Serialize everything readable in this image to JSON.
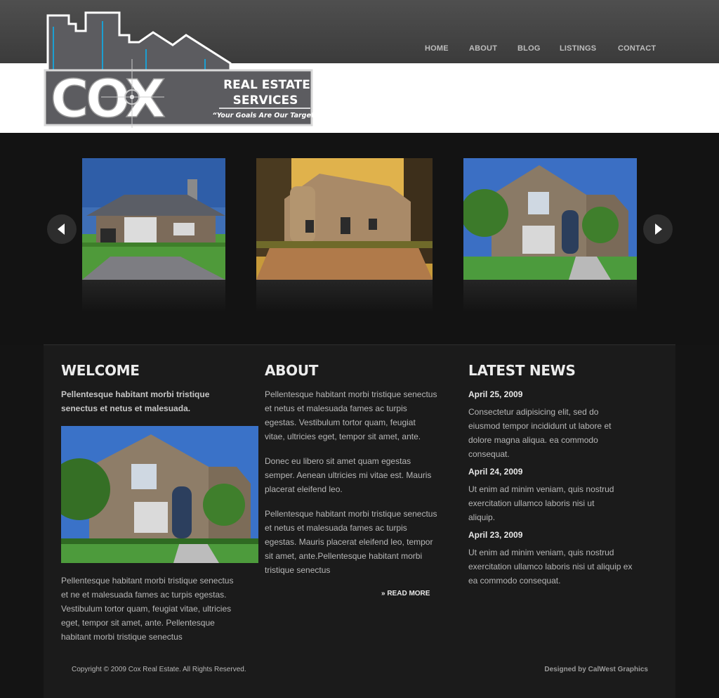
{
  "brand": {
    "name": "COX",
    "subtitle_line1": "REAL ESTATE",
    "subtitle_line2": "SERVICES",
    "tagline": "“Your Goals Are Our Target”"
  },
  "nav": {
    "items": [
      "HOME",
      "ABOUT",
      "BLOG",
      "LISTINGS",
      "CONTACT"
    ]
  },
  "slider": {
    "prev_icon": "arrow-left-icon",
    "next_icon": "arrow-right-icon"
  },
  "welcome": {
    "title": "WELCOME",
    "lead": "Pellentesque habitant morbi tristique senectus et netus et malesuada.",
    "body": "Pellentesque habitant morbi tristique senectus et ne et malesuada fames ac turpis egestas. Vestibulum tortor quam, feugiat vitae, ultricies eget, tempor sit amet, ante. Pellentesque habitant morbi tristique senectus"
  },
  "about": {
    "title": "ABOUT",
    "paragraphs": [
      "Pellentesque habitant morbi tristique senectus et netus et malesuada fames ac turpis egestas. Vestibulum tortor quam, feugiat vitae, ultricies eget, tempor sit amet, ante.",
      "Donec eu libero sit amet quam egestas semper. Aenean ultricies mi vitae est. Mauris placerat eleifend leo.",
      "Pellentesque habitant morbi tristique senectus et netus et malesuada fames ac turpis egestas. Mauris placerat eleifend leo, tempor sit amet, ante.Pellentesque habitant morbi tristique senectus"
    ],
    "read_more": "» READ MORE"
  },
  "news": {
    "title": "LATEST NEWS",
    "items": [
      {
        "date": "April 25, 2009",
        "text": "Consectetur adipisicing elit, sed do eiusmod tempor incididunt ut labore et dolore magna aliqua. ea commodo consequat."
      },
      {
        "date": "April 24, 2009",
        "text": "Ut enim ad minim veniam, quis nostrud exercitation ullamco laboris nisi ut aliquip."
      },
      {
        "date": "April 23, 2009",
        "text": "Ut enim ad minim veniam, quis nostrud exercitation ullamco laboris nisi ut aliquip ex ea commodo consequat."
      }
    ]
  },
  "footer": {
    "copyright": "Copyright © 2009 Cox Real Estate. All Rights Reserved.",
    "credit": "Designed by CalWest Graphics"
  },
  "colors": {
    "background": "#141414",
    "panel": "#1b1b1b",
    "header": "#444444",
    "accent_blue": "#1c9fd1"
  }
}
